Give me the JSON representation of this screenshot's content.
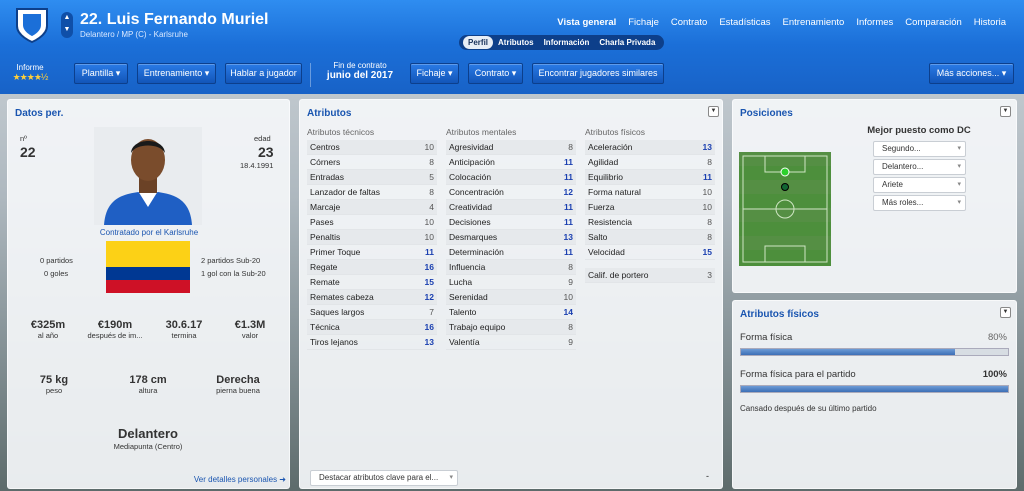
{
  "header": {
    "number_name": "22. Luis Fernando Muriel",
    "subtitle": "Delantero / MP (C) - Karlsruhe",
    "nav": [
      "Vista general",
      "Fichaje",
      "Contrato",
      "Estadísticas",
      "Entrenamiento",
      "Informes",
      "Comparación",
      "Historia"
    ],
    "subtabs": [
      "Perfil",
      "Atributos",
      "Información",
      "Charla Privada"
    ]
  },
  "toolbar": {
    "report_label": "Informe",
    "stars": "★★★★½",
    "plantilla": "Plantilla ▾",
    "entrenamiento": "Entrenamiento ▾",
    "hablar": "Hablar a jugador",
    "contract_label": "Fin de contrato",
    "contract_date": "junio del 2017",
    "fichaje": "Fichaje ▾",
    "contrato": "Contrato ▾",
    "encontrar": "Encontrar jugadores similares",
    "mas": "Más acciones... ▾"
  },
  "personal": {
    "title": "Datos per.",
    "no_label": "nº",
    "no": "22",
    "age_label": "edad",
    "age": "23",
    "dob": "18.4.1991",
    "signed": "Contratado por el Karlsruhe",
    "left_stats": [
      "0 partidos",
      "0 goles"
    ],
    "right_stats": [
      "2 partidos Sub-20",
      "1 gol con la Sub-20"
    ],
    "money": [
      {
        "v": "€325m",
        "l": "al año"
      },
      {
        "v": "€190m",
        "l": "después de im..."
      },
      {
        "v": "30.6.17",
        "l": "termina"
      },
      {
        "v": "€1.3M",
        "l": "valor"
      }
    ],
    "body": [
      {
        "v": "75 kg",
        "l": "peso"
      },
      {
        "v": "178 cm",
        "l": "altura"
      },
      {
        "v": "Derecha",
        "l": "pierna buena"
      }
    ],
    "role": "Delantero",
    "role_sub": "Mediapunta (Centro)",
    "details_link": "Ver detalles personales ➜"
  },
  "attributes": {
    "title": "Atributos",
    "tech_head": "Atributos técnicos",
    "mental_head": "Atributos mentales",
    "phys_head": "Atributos físicos",
    "technical": [
      [
        "Centros",
        "10"
      ],
      [
        "Córners",
        "8"
      ],
      [
        "Entradas",
        "5"
      ],
      [
        "Lanzador de faltas",
        "8"
      ],
      [
        "Marcaje",
        "4"
      ],
      [
        "Pases",
        "10"
      ],
      [
        "Penaltis",
        "10"
      ],
      [
        "Primer Toque",
        "11"
      ],
      [
        "Regate",
        "16"
      ],
      [
        "Remate",
        "15"
      ],
      [
        "Remates cabeza",
        "12"
      ],
      [
        "Saques largos",
        "7"
      ],
      [
        "Técnica",
        "16"
      ],
      [
        "Tiros lejanos",
        "13"
      ]
    ],
    "mental": [
      [
        "Agresividad",
        "8"
      ],
      [
        "Anticipación",
        "11"
      ],
      [
        "Colocación",
        "11"
      ],
      [
        "Concentración",
        "12"
      ],
      [
        "Creatividad",
        "11"
      ],
      [
        "Decisiones",
        "11"
      ],
      [
        "Desmarques",
        "13"
      ],
      [
        "Determinación",
        "11"
      ],
      [
        "Influencia",
        "8"
      ],
      [
        "Lucha",
        "9"
      ],
      [
        "Serenidad",
        "10"
      ],
      [
        "Talento",
        "14"
      ],
      [
        "Trabajo equipo",
        "8"
      ],
      [
        "Valentía",
        "9"
      ]
    ],
    "physical": [
      [
        "Aceleración",
        "13"
      ],
      [
        "Agilidad",
        "8"
      ],
      [
        "Equilibrio",
        "11"
      ],
      [
        "Forma natural",
        "10"
      ],
      [
        "Fuerza",
        "10"
      ],
      [
        "Resistencia",
        "8"
      ],
      [
        "Salto",
        "8"
      ],
      [
        "Velocidad",
        "15"
      ]
    ],
    "gk": [
      "Calif. de portero",
      "3"
    ],
    "highlight": "Destacar atributos clave para el...",
    "dash": "-"
  },
  "positions": {
    "title": "Posiciones",
    "best": "Mejor puesto como DC",
    "options": [
      "Segundo...",
      "Delantero...",
      "Ariete",
      "Más roles..."
    ]
  },
  "fitness": {
    "title": "Atributos físicos",
    "f1_label": "Forma física",
    "f1_value": "80%",
    "f1_level": 0.8,
    "f2_label": "Forma física para el partido",
    "f2_value": "100%",
    "f2_level": 1.0,
    "note": "Cansado después de su último partido"
  },
  "colors": {
    "accent": "#1b6fd8",
    "high_value": "#1a3fb0",
    "bar": "#3c6eb6",
    "pitch": "#4d8f3c"
  }
}
